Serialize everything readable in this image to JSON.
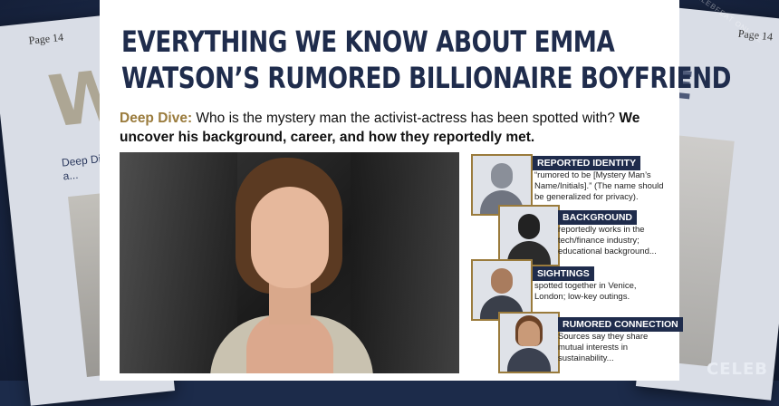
{
  "background": {
    "left_page_label": "Page 14",
    "left_big_letter": "W",
    "left_snippet": "Deep Dive... actress a...",
    "right_page_label": "Page 14",
    "right_big_letter": "E",
    "watermark": "CELEBFEAT ONLINE",
    "brand": "CELEB"
  },
  "article": {
    "headline_line1": "EVERYTHING WE KNOW ABOUT EMMA",
    "headline_line2": "WATSON’S RUMORED BILLIONAIRE BOYFRIEND",
    "deck_lead": "Deep Dive:",
    "deck_text": " Who is the mystery man the activist-actress has been spotted with? ",
    "deck_bold": "We uncover his background, career, and how they reportedly met."
  },
  "profiles": [
    {
      "title": "REPORTED IDENTITY",
      "text": "“rumored to be [Mystery Man’s Name/Initials].” (The name should be generalized for privacy).",
      "icon": "man-silhouette-icon"
    },
    {
      "title": "BACKGROUND",
      "text": "reportedly works in the tech/finance industry; educational background...",
      "icon": "man-dark-silhouette-icon"
    },
    {
      "title": "SIGHTINGS",
      "text": "spotted together in Venice, London; low-key outings.",
      "icon": "man-beard-icon"
    },
    {
      "title": "RUMORED CONNECTION",
      "text": "Sources say they share mutual interests in sustainability...",
      "icon": "woman-icon"
    }
  ],
  "colors": {
    "navy": "#1f2c4c",
    "gold": "#9a7b3c"
  }
}
